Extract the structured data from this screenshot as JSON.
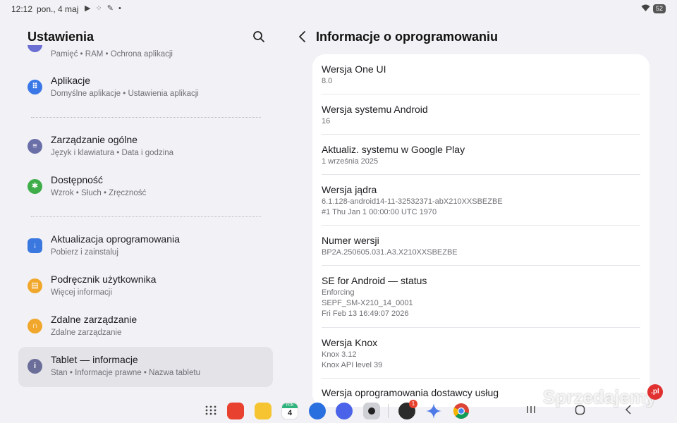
{
  "status_bar": {
    "time": "12:12",
    "date": "pon., 4 maj",
    "notification_icons": "▶ ⁘ ✎ •",
    "battery": "52"
  },
  "left": {
    "title": "Ustawienia",
    "partial_item_sub": "Pamięć  •  RAM  •  Ochrona aplikacji",
    "items": [
      {
        "title": "Aplikacje",
        "sub": "Domyślne aplikacje  •  Ustawienia aplikacji",
        "icon": "apps-icon",
        "color": "#3b78e7",
        "glyph": "⠿"
      },
      {
        "title": "Zarządzanie ogólne",
        "sub": "Język i klawiatura  •  Data i godzina",
        "icon": "sliders-icon",
        "color": "#6b6fa8",
        "glyph": "≡"
      },
      {
        "title": "Dostępność",
        "sub": "Wzrok  •  Słuch  •  Zręczność",
        "icon": "accessibility-icon",
        "color": "#3fae4a",
        "glyph": "✱"
      },
      {
        "title": "Aktualizacja oprogramowania",
        "sub": "Pobierz i zainstaluj",
        "icon": "update-icon",
        "color": "#3a78e0",
        "glyph": "↓"
      },
      {
        "title": "Podręcznik użytkownika",
        "sub": "Więcej informacji",
        "icon": "manual-icon",
        "color": "#f0a72c",
        "glyph": "▤"
      },
      {
        "title": "Zdalne zarządzanie",
        "sub": "Zdalne zarządzanie",
        "icon": "headset-icon",
        "color": "#f0a72c",
        "glyph": "∩"
      },
      {
        "title": "Tablet — informacje",
        "sub": "Stan  •  Informacje prawne  •  Nazwa tabletu",
        "icon": "info-icon",
        "color": "#6a6e99",
        "glyph": "i"
      }
    ]
  },
  "right": {
    "title": "Informacje o oprogramowaniu",
    "rows": [
      {
        "title": "Wersja One UI",
        "lines": [
          "8.0"
        ]
      },
      {
        "title": "Wersja systemu Android",
        "lines": [
          "16"
        ]
      },
      {
        "title": "Aktualiz. systemu w Google Play",
        "lines": [
          "1 września 2025"
        ]
      },
      {
        "title": "Wersja jądra",
        "lines": [
          "6.1.128-android14-11-32532371-abX210XXSBEZBE",
          "#1 Thu Jan  1 00:00:00 UTC 1970"
        ]
      },
      {
        "title": "Numer wersji",
        "lines": [
          "BP2A.250605.031.A3.X210XXSBEZBE"
        ]
      },
      {
        "title": "SE for Android — status",
        "lines": [
          "Enforcing",
          "SEPF_SM-X210_14_0001",
          "Fri Feb 13 16:49:07 2026"
        ]
      },
      {
        "title": "Wersja Knox",
        "lines": [
          "Knox 3.12",
          "Knox API level 39"
        ]
      },
      {
        "title": "Wersja oprogramowania dostawcy usług",
        "lines": []
      }
    ]
  },
  "dock": {
    "calendar_day": "4",
    "calendar_weekday": "PON",
    "badge": "1"
  },
  "watermark": {
    "text": "Sprzedajemy",
    "tld": ".pl"
  }
}
